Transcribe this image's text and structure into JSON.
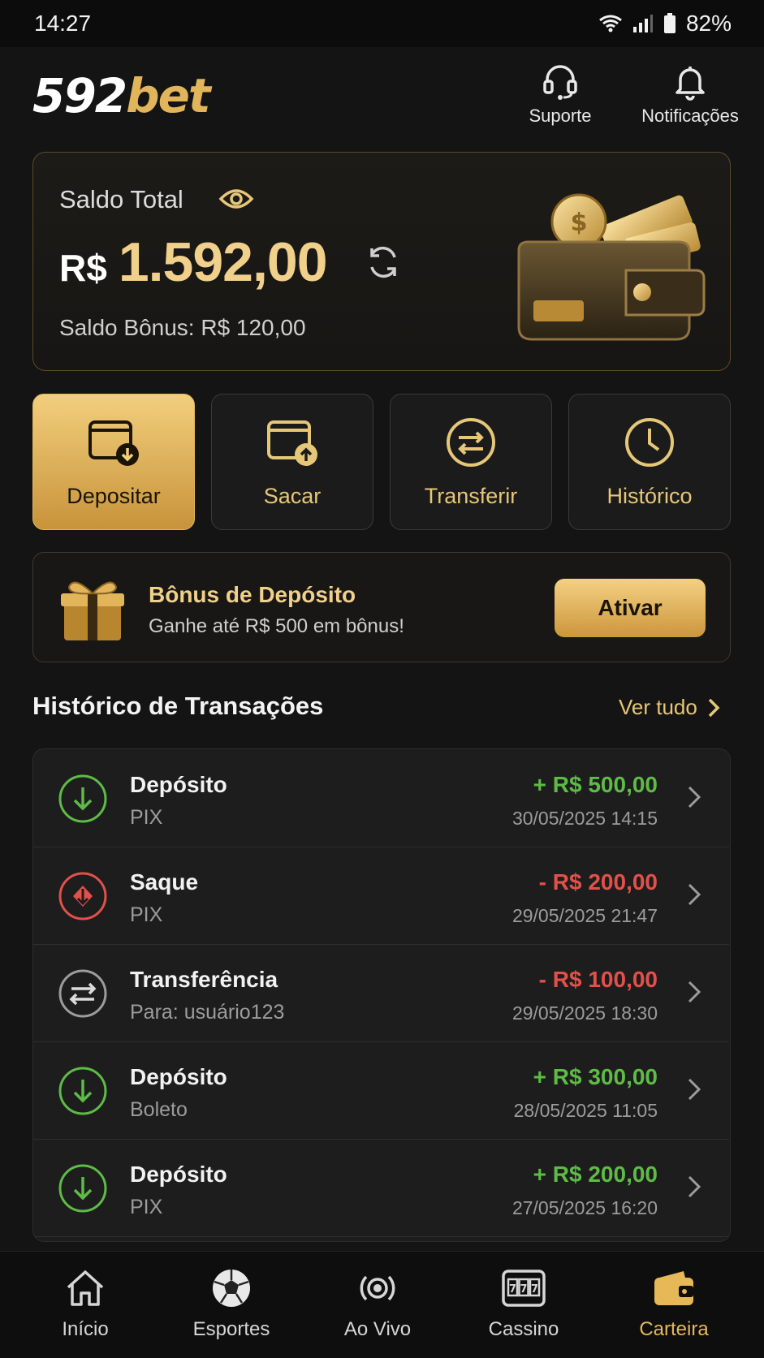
{
  "status_bar": {
    "time": "14:27",
    "battery": "82%"
  },
  "header": {
    "logo_number": "592",
    "logo_word": "bet",
    "support_label": "Suporte",
    "notifications_label": "Notificações"
  },
  "balance": {
    "label": "Saldo Total",
    "currency": "R$",
    "amount": "1.592,00",
    "bonus": "Saldo Bônus: R$ 120,00"
  },
  "actions": [
    {
      "label": "Depositar",
      "icon": "wallet-deposit-icon"
    },
    {
      "label": "Sacar",
      "icon": "wallet-withdraw-icon"
    },
    {
      "label": "Transferir",
      "icon": "transfer-icon"
    },
    {
      "label": "Histórico",
      "icon": "clock-icon"
    }
  ],
  "promo": {
    "title": "Bônus de Depósito",
    "subtitle": "Ganhe até R$ 500 em bônus!",
    "button": "Ativar"
  },
  "transactions_section": {
    "title": "Histórico de Transações",
    "see_all": "Ver tudo"
  },
  "transactions": [
    {
      "type": "Depósito",
      "method": "PIX",
      "amount": "+ R$ 500,00",
      "date": "30/05/2025 14:15",
      "direction": "in"
    },
    {
      "type": "Saque",
      "method": "PIX",
      "amount": "- R$ 200,00",
      "date": "29/05/2025 21:47",
      "direction": "out"
    },
    {
      "type": "Transferência",
      "method": "Para: usuário123",
      "amount": "- R$ 100,00",
      "date": "29/05/2025 18:30",
      "direction": "transfer"
    },
    {
      "type": "Depósito",
      "method": "Boleto",
      "amount": "+ R$ 300,00",
      "date": "28/05/2025 11:05",
      "direction": "in"
    },
    {
      "type": "Depósito",
      "method": "PIX",
      "amount": "+ R$ 200,00",
      "date": "27/05/2025 16:20",
      "direction": "in"
    }
  ],
  "bottom_nav": [
    {
      "label": "Início",
      "icon": "home-icon"
    },
    {
      "label": "Esportes",
      "icon": "soccer-ball-icon"
    },
    {
      "label": "Ao Vivo",
      "icon": "live-broadcast-icon"
    },
    {
      "label": "Cassino",
      "icon": "slot-machine-icon"
    },
    {
      "label": "Carteira",
      "icon": "wallet-icon",
      "active": true
    }
  ],
  "colors": {
    "accent": "#e2b55b",
    "positive": "#5dbb46",
    "negative": "#e2504a",
    "background": "#141414"
  }
}
